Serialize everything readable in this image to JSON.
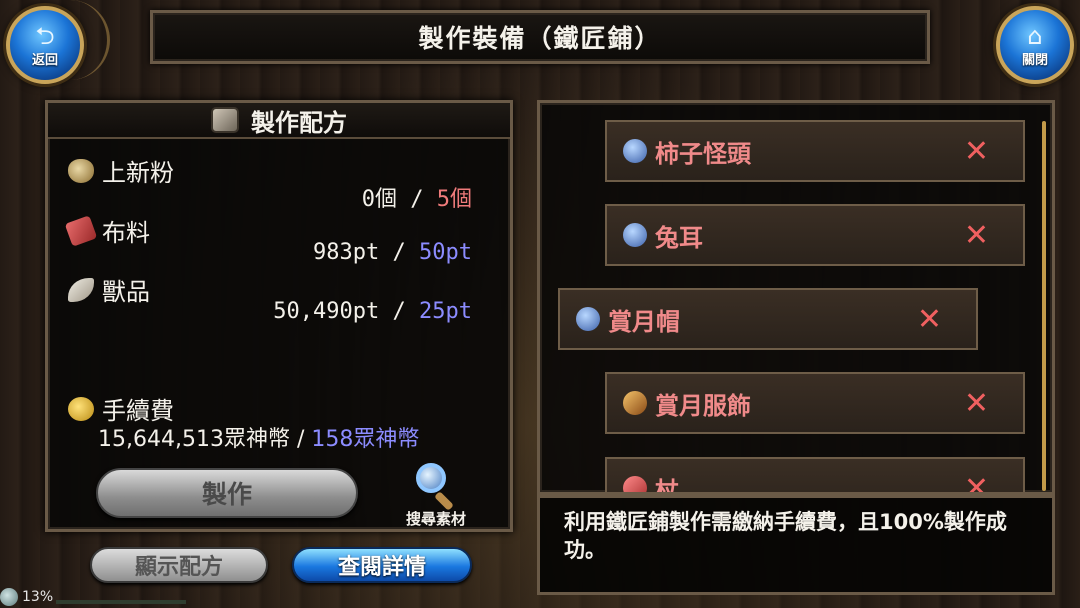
{
  "header": {
    "title": "製作裝備（鐵匠鋪）",
    "back_label": "返回",
    "close_label": "關閉"
  },
  "recipe": {
    "header": "製作配方",
    "materials": [
      {
        "name": "上新粉",
        "have": "0個",
        "sep": "/",
        "need": "5個",
        "need_color": "#f07b7b",
        "icon": "powder-icon"
      },
      {
        "name": "布料",
        "have": "983pt",
        "sep": "/",
        "need": "50pt",
        "need_color": "#8c8cff",
        "icon": "cloth-icon"
      },
      {
        "name": "獸品",
        "have": "50,490pt",
        "sep": "/",
        "need": "25pt",
        "need_color": "#8c8cff",
        "icon": "fang-icon"
      }
    ],
    "fee": {
      "name": "手續費",
      "have": "15,644,513眾神幣",
      "sep": "/",
      "need": "158眾神幣",
      "icon": "coin-icon"
    },
    "craft_label": "製作",
    "search_label": "搜尋素材"
  },
  "bottom": {
    "show_recipe_label": "顯示配方",
    "view_detail_label": "查閱詳情"
  },
  "status": {
    "percent_text": "13%",
    "progress": 0.13
  },
  "list": {
    "items": [
      {
        "name": "柿子怪頭",
        "icon": "hat-icon",
        "mark": "✕"
      },
      {
        "name": "兔耳",
        "icon": "hat-icon",
        "mark": "✕"
      },
      {
        "name": "賞月帽",
        "icon": "hat-icon",
        "mark": "✕"
      },
      {
        "name": "賞月服飾",
        "icon": "clothes-icon",
        "mark": "✕"
      },
      {
        "name": "杖",
        "icon": "staff-icon",
        "mark": "✕"
      }
    ]
  },
  "info": {
    "text": "利用鐵匠鋪製作需繳納手續費，且100%製作成功。"
  }
}
